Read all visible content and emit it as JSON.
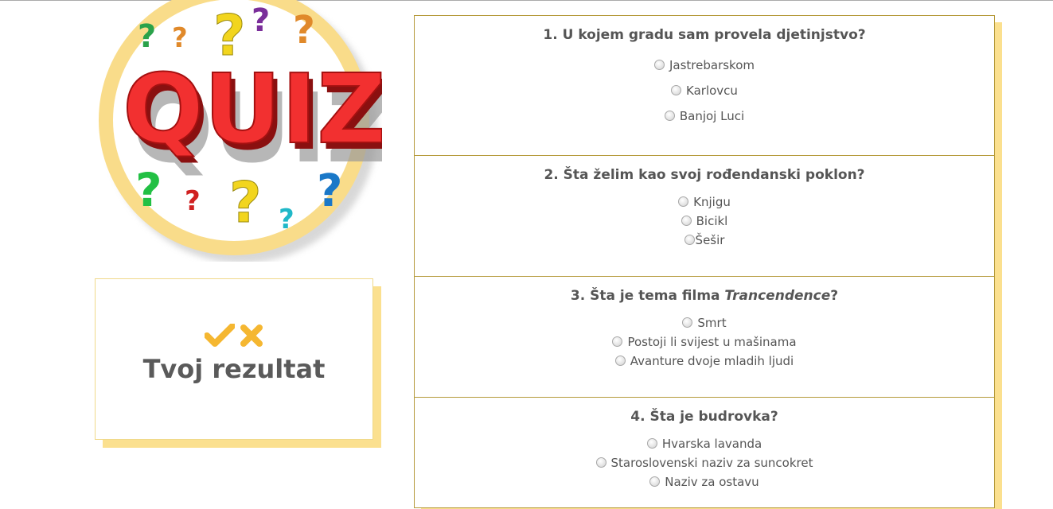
{
  "logo": {
    "label": "QUIZ"
  },
  "score": {
    "title": "Tvoj rezultat",
    "check_icon": "check-icon",
    "cross_icon": "cross-icon",
    "accent": "#f5b731"
  },
  "colors": {
    "border": "#b59a3a",
    "shadow": "#fbe08f",
    "text": "#555555"
  },
  "questions": [
    {
      "number": "1.",
      "title": "U kojem gradu sam provela djetinjstvo?",
      "options": [
        "Jastrebarskom",
        "Karlovcu",
        "Banjoj Luci"
      ]
    },
    {
      "number": "2.",
      "title": "Šta želim kao svoj rođendanski poklon?",
      "options": [
        "Knjigu",
        "Bicikl",
        "Šešir"
      ]
    },
    {
      "number": "3.",
      "title_pre": "Šta je tema filma ",
      "title_em": "Trancendence",
      "title_post": "?",
      "options": [
        "Smrt",
        "Postoji li svijest u mašinama",
        "Avanture dvoje mladih ljudi"
      ]
    },
    {
      "number": "4.",
      "title": "Šta je budrovka?",
      "options": [
        "Hvarska lavanda",
        "Staroslovenski naziv za suncokret",
        "Naziv za ostavu"
      ]
    }
  ]
}
